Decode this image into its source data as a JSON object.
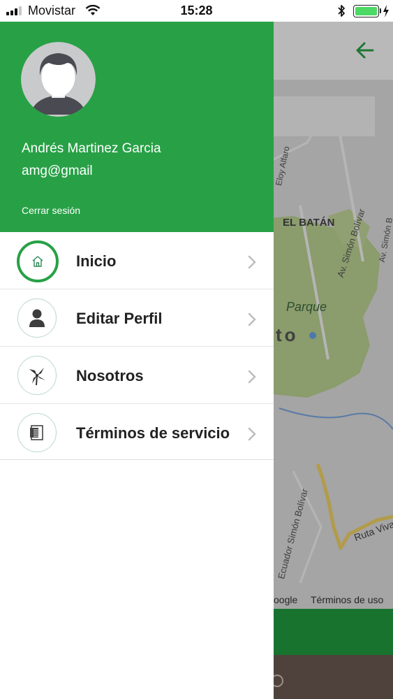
{
  "status_bar": {
    "carrier": "Movistar",
    "time": "15:28",
    "icons": [
      "signal-icon",
      "wifi-icon",
      "bluetooth-icon",
      "battery-icon",
      "charging-icon"
    ]
  },
  "drawer": {
    "user_name": "Andrés Martinez Garcia",
    "user_email": "amg@gmail",
    "logout_label": "Cerrar sesión",
    "menu": [
      {
        "label": "Inicio",
        "icon": "home-icon",
        "active": true
      },
      {
        "label": "Editar Perfil",
        "icon": "person-icon",
        "active": false
      },
      {
        "label": "Nosotros",
        "icon": "pinwheel-icon",
        "active": false
      },
      {
        "label": "Términos de servicio",
        "icon": "document-icon",
        "active": false
      }
    ]
  },
  "background_map": {
    "labels": [
      "EL BATÁN",
      "Parque",
      "Av. Simón Bolívar",
      "Av. Simón B",
      "Ruta Viva",
      "Ecuador Simón Bolívar",
      "Eloy Alfaro",
      "to"
    ],
    "google_attribution": "oogle",
    "terms_link": "Términos de uso"
  },
  "colors": {
    "primary_green": "#28a146",
    "map_green": "#bcd393",
    "route_yellow": "#f0d264",
    "bottom_bar": "#6b5a52"
  }
}
